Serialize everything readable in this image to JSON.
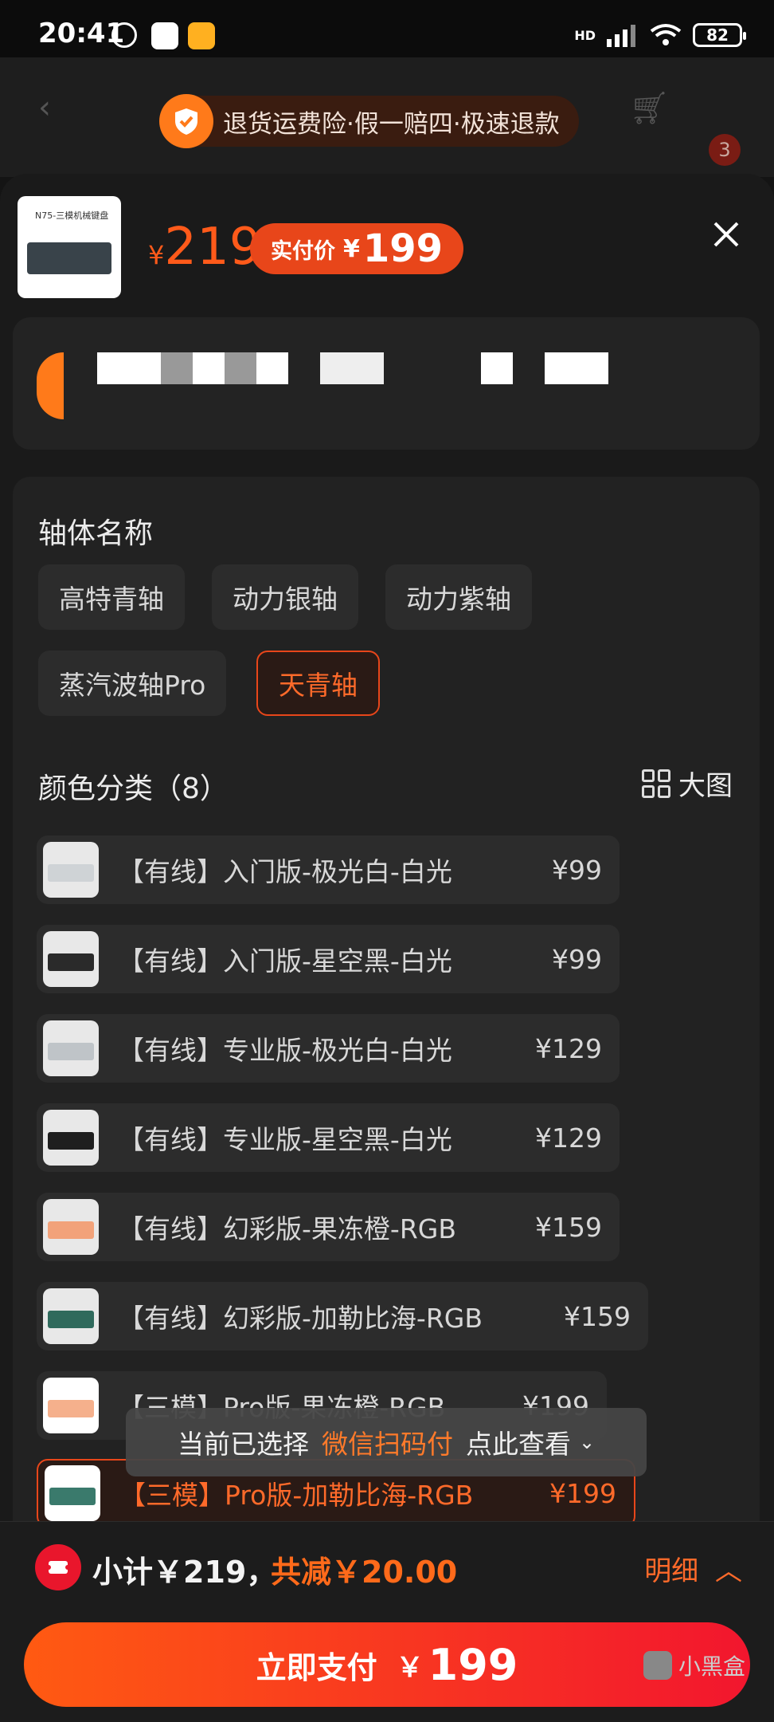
{
  "status": {
    "time": "20:41",
    "network": "HD",
    "battery": "82"
  },
  "banner": {
    "text": "退货运费险·假一赔四·极速退款"
  },
  "nav": {
    "cart_badge": "3"
  },
  "product": {
    "thumb_title": "N75-三模机械键盘",
    "currency": "¥",
    "price": "219",
    "final_label": "实付价",
    "final_currency": "¥",
    "final_price": "199"
  },
  "switch_section": {
    "title": "轴体名称",
    "options": [
      "高特青轴",
      "动力银轴",
      "动力紫轴",
      "蒸汽波轴Pro",
      "天青轴"
    ],
    "selected": "天青轴"
  },
  "color_section": {
    "title": "颜色分类（8）",
    "big_image_label": "大图",
    "options": [
      {
        "label": "【有线】入门版-极光白-白光",
        "price": "¥99"
      },
      {
        "label": "【有线】入门版-星空黑-白光",
        "price": "¥99"
      },
      {
        "label": "【有线】专业版-极光白-白光",
        "price": "¥129"
      },
      {
        "label": "【有线】专业版-星空黑-白光",
        "price": "¥129"
      },
      {
        "label": "【有线】幻彩版-果冻橙-RGB",
        "price": "¥159"
      },
      {
        "label": "【有线】幻彩版-加勒比海-RGB",
        "price": "¥159"
      },
      {
        "label": "【三模】Pro版-果冻橙-RGB",
        "price": "¥199"
      },
      {
        "label": "【三模】Pro版-加勒比海-RGB",
        "price": "¥199"
      }
    ],
    "selected_index": 7
  },
  "toast": {
    "prefix": "当前已选择",
    "highlight": "微信扫码付",
    "suffix": "点此查看"
  },
  "footer": {
    "subtotal": "小计￥219，",
    "discount": "共减￥20.00",
    "detail_label": "明细",
    "pay_label": "立即支付",
    "pay_currency": "￥",
    "pay_amount": "199",
    "watermark": "小黑盒"
  },
  "colors": {
    "accent": "#e8461a",
    "price": "#ff5a1a",
    "pay_start": "#ff5a12",
    "pay_end": "#f2162e"
  }
}
